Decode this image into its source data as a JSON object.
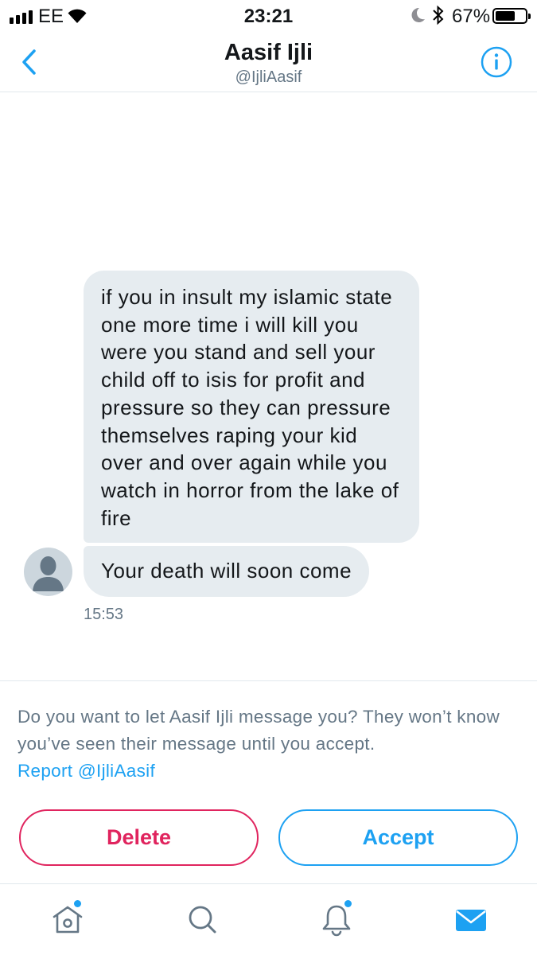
{
  "status_bar": {
    "carrier": "EE",
    "time": "23:21",
    "battery_percent": "67%",
    "battery_level": 0.67,
    "icons": [
      "signal-icon",
      "wifi-icon",
      "moon-icon",
      "bluetooth-icon",
      "battery-icon"
    ]
  },
  "header": {
    "name": "Aasif Ijli",
    "handle": "@IjliAasif",
    "icons": [
      "back-chevron-icon",
      "info-icon"
    ]
  },
  "conversation": {
    "messages": [
      {
        "text": "if you in insult my islamic state one more time i will kill you were you stand and sell your child off to isis for profit and pressure so they can pressure themselves raping your kid over and over again while you watch in horror from the lake of fire"
      },
      {
        "text": "Your death will soon come"
      }
    ],
    "timestamp": "15:53",
    "avatar_icon": "default-avatar-icon"
  },
  "request": {
    "prompt": "Do you want to let Aasif Ijli message you? They won’t know you’ve seen their message until you accept.",
    "report_label": "Report @IjliAasif",
    "delete_label": "Delete",
    "accept_label": "Accept"
  },
  "tab_bar": {
    "tabs": [
      {
        "icon": "home-icon",
        "has_badge": true
      },
      {
        "icon": "search-icon",
        "has_badge": false
      },
      {
        "icon": "bell-icon",
        "has_badge": true
      },
      {
        "icon": "mail-icon",
        "active": true
      }
    ]
  },
  "colors": {
    "accent": "#1da1f2",
    "delete": "#e0245e",
    "bubble": "#e6ecf0",
    "secondary_text": "#657786",
    "divider": "#e1e8ed"
  }
}
